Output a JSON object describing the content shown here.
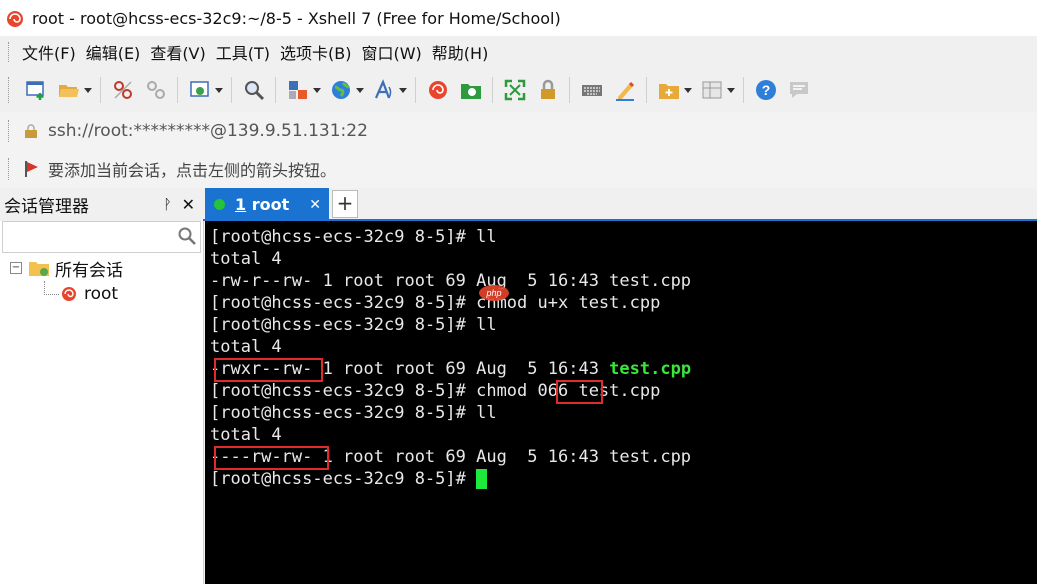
{
  "window": {
    "title": "root - root@hcss-ecs-32c9:~/8-5 - Xshell 7 (Free for Home/School)"
  },
  "menu": [
    "文件(F)",
    "编辑(E)",
    "查看(V)",
    "工具(T)",
    "选项卡(B)",
    "窗口(W)",
    "帮助(H)"
  ],
  "address": {
    "value": "ssh://root:*********@139.9.51.131:22"
  },
  "hint": {
    "text": "要添加当前会话，点击左侧的箭头按钮。"
  },
  "sidebar": {
    "title": "会话管理器",
    "pin": "ᚹ",
    "close": "✕",
    "tree": {
      "root_label": "所有会话",
      "child_label": "root",
      "toggle": "−"
    }
  },
  "tabs": [
    {
      "number": "1",
      "label": "root",
      "close": "✕"
    }
  ],
  "tab_add": "+",
  "terminal": {
    "lines": [
      "[root@hcss-ecs-32c9 8-5]# ll",
      "total 4",
      "-rw-r--rw- 1 root root 69 Aug  5 16:43 test.cpp",
      "[root@hcss-ecs-32c9 8-5]# chmod u+x test.cpp",
      "[root@hcss-ecs-32c9 8-5]# ll",
      "total 4",
      "-rwxr--rw- 1 root root 69 Aug  5 16:43 ",
      "[root@hcss-ecs-32c9 8-5]# chmod 066 test.cpp",
      "[root@hcss-ecs-32c9 8-5]# ll",
      "total 4",
      "----rw-rw- 1 root root 69 Aug  5 16:43 test.cpp",
      "[root@hcss-ecs-32c9 8-5]# "
    ],
    "executable_name": "test.cpp"
  },
  "colors": {
    "tab_active": "#1a73d1",
    "terminal_bg": "#000000",
    "cursor": "#1dea3a",
    "highlight_box": "#e02b2b"
  }
}
